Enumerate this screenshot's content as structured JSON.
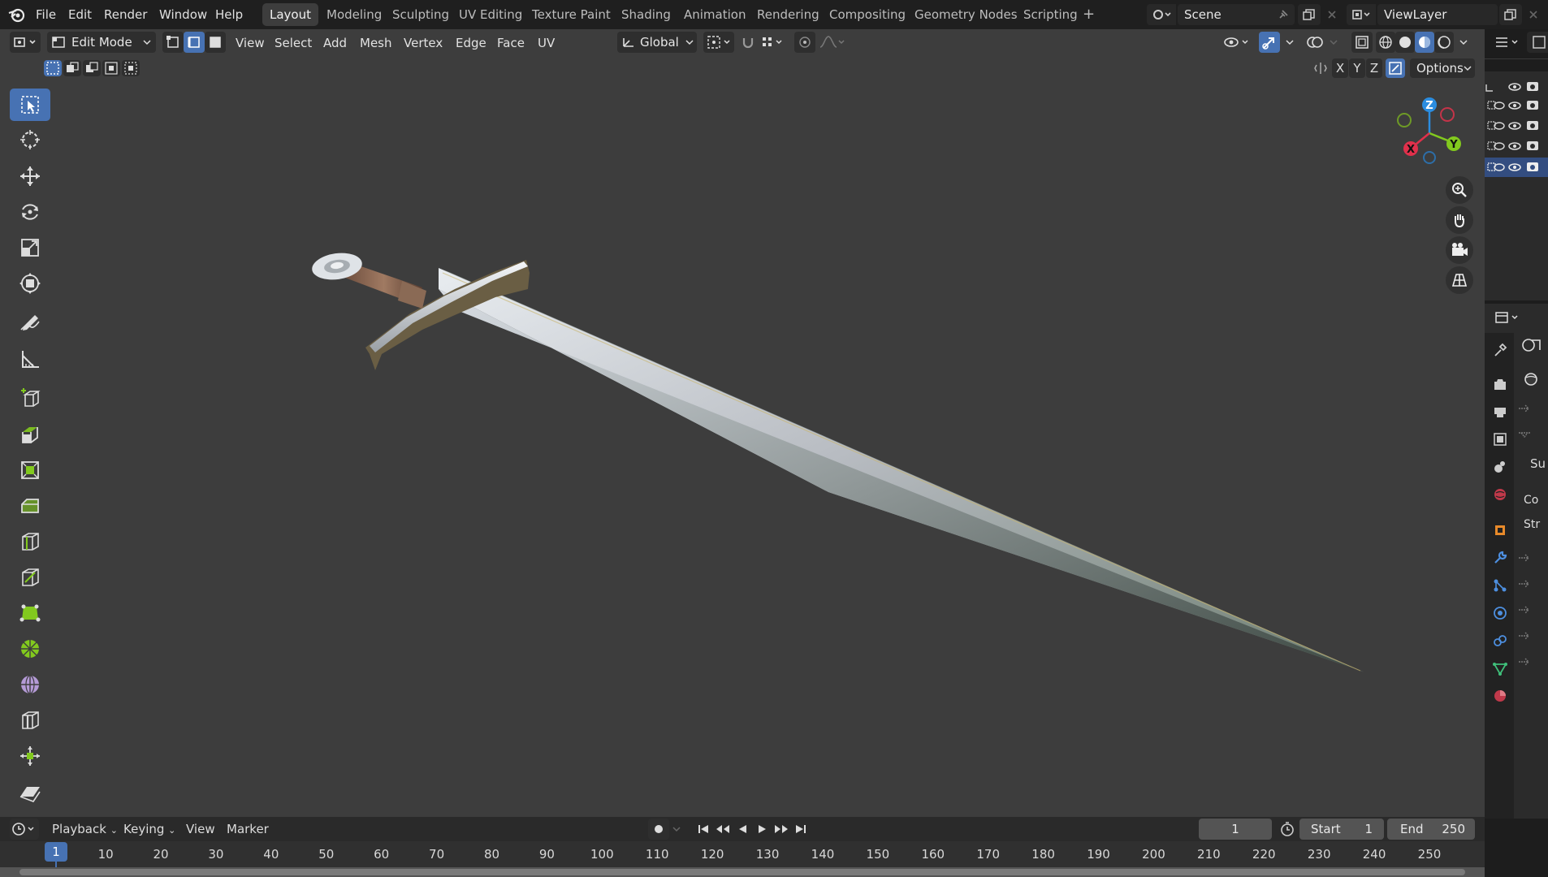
{
  "menu": [
    "File",
    "Edit",
    "Render",
    "Window",
    "Help"
  ],
  "workspaces": [
    "Layout",
    "Modeling",
    "Sculpting",
    "UV Editing",
    "Texture Paint",
    "Shading",
    "Animation",
    "Rendering",
    "Compositing",
    "Geometry Nodes",
    "Scripting"
  ],
  "active_workspace": "Layout",
  "add_workspace_label": "+",
  "scene_name": "Scene",
  "view_layer": "ViewLayer",
  "viewport_header": {
    "mode": "Edit Mode",
    "menus": [
      "View",
      "Select",
      "Add",
      "Mesh",
      "Vertex",
      "Edge",
      "Face",
      "UV"
    ],
    "transform_orientation": "Global",
    "axis_labels": [
      "X",
      "Y",
      "Z"
    ],
    "options_label": "Options"
  },
  "gizmo": {
    "x": "X",
    "y": "Y",
    "z": "Z"
  },
  "timeline": {
    "menus": [
      "Playback",
      "Keying",
      "View",
      "Marker"
    ],
    "current_frame": "1",
    "start_label": "Start",
    "start_value": "1",
    "end_label": "End",
    "end_value": "250",
    "playhead_frame": "1",
    "ticks": [
      "10",
      "20",
      "30",
      "40",
      "50",
      "60",
      "70",
      "80",
      "90",
      "100",
      "110",
      "120",
      "130",
      "140",
      "150",
      "160",
      "170",
      "180",
      "190",
      "200",
      "210",
      "220",
      "230",
      "240",
      "250"
    ]
  },
  "props_partial_text": [
    "Su",
    "Co",
    "Str"
  ],
  "colors": {
    "accent": "#4772b3",
    "viewport_bg": "#3d3d3d",
    "header_bg": "#1f1f1f",
    "x_axis": "#e0304b",
    "y_axis": "#82c91e",
    "z_axis": "#2b8de0"
  }
}
